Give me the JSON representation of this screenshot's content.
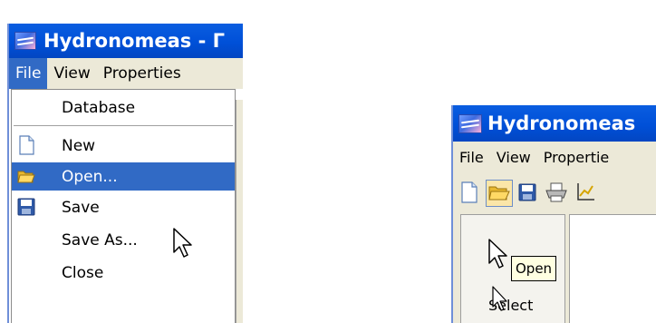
{
  "left_window": {
    "title": "Hydronomeas - Γ",
    "menu": [
      "File",
      "View",
      "Properties"
    ],
    "file_menu": {
      "database": "Database",
      "new": "New",
      "open": "Open...",
      "save": "Save",
      "save_as": "Save As...",
      "close": "Close"
    }
  },
  "right_window": {
    "title": "Hydronomeas",
    "menu": [
      "File",
      "View",
      "Propertie"
    ],
    "tooltip": "Open",
    "select_label": "Select"
  },
  "colors": {
    "titlebar": "#0050d8",
    "highlight": "#316ac5",
    "menubar": "#ece9d8",
    "tooltip_bg": "#ffffe1"
  }
}
